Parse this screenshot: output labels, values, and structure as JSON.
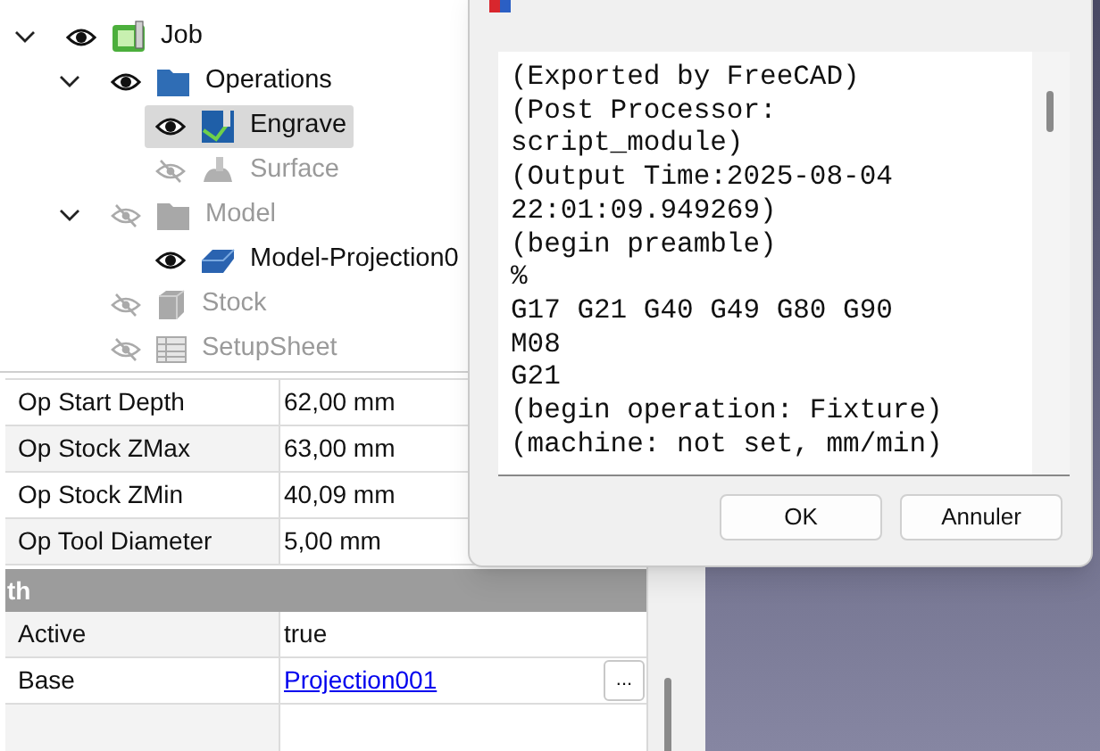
{
  "tree": [
    {
      "label": "Job",
      "kind": "job",
      "visible": true,
      "selected": false,
      "expanded": true,
      "children": [
        {
          "label": "Operations",
          "kind": "folder",
          "visible": true,
          "selected": false,
          "expanded": true,
          "children": [
            {
              "label": "Engrave",
              "kind": "engrave",
              "visible": true,
              "selected": true
            },
            {
              "label": "Surface",
              "kind": "surface",
              "visible": false,
              "selected": false
            }
          ]
        },
        {
          "label": "Model",
          "kind": "folder",
          "visible": false,
          "selected": false,
          "expanded": true,
          "children": [
            {
              "label": "Model-Projection0",
              "kind": "solid",
              "visible": true,
              "selected": false
            }
          ]
        },
        {
          "label": "Stock",
          "kind": "box",
          "visible": false,
          "selected": false
        },
        {
          "label": "SetupSheet",
          "kind": "sheet",
          "visible": false,
          "selected": false
        }
      ]
    }
  ],
  "properties": [
    {
      "kind": "row",
      "name": "Op Start Depth",
      "value": "62,00 mm"
    },
    {
      "kind": "row",
      "name": "Op Stock ZMax",
      "value": "63,00 mm"
    },
    {
      "kind": "row",
      "name": "Op Stock ZMin",
      "value": "40,09 mm"
    },
    {
      "kind": "row",
      "name": "Op Tool Diameter",
      "value": "5,00 mm"
    },
    {
      "kind": "group",
      "name": "th"
    },
    {
      "kind": "row",
      "name": "Active",
      "value": "true"
    },
    {
      "kind": "link",
      "name": "Base",
      "value": "Projection001",
      "button": "..."
    },
    {
      "kind": "empty"
    }
  ],
  "dialog": {
    "lines": [
      "(Exported by FreeCAD)",
      "(Post Processor:",
      "script_module)",
      "(Output Time:2025-08-04",
      "22:01:09.949269)",
      "(begin preamble)",
      "%",
      "G17 G21 G40 G49 G80 G90",
      "M08",
      "G21",
      "(begin operation: Fixture)",
      "(machine: not set, mm/min)"
    ],
    "buttons": [
      "OK",
      "Annuler"
    ]
  }
}
